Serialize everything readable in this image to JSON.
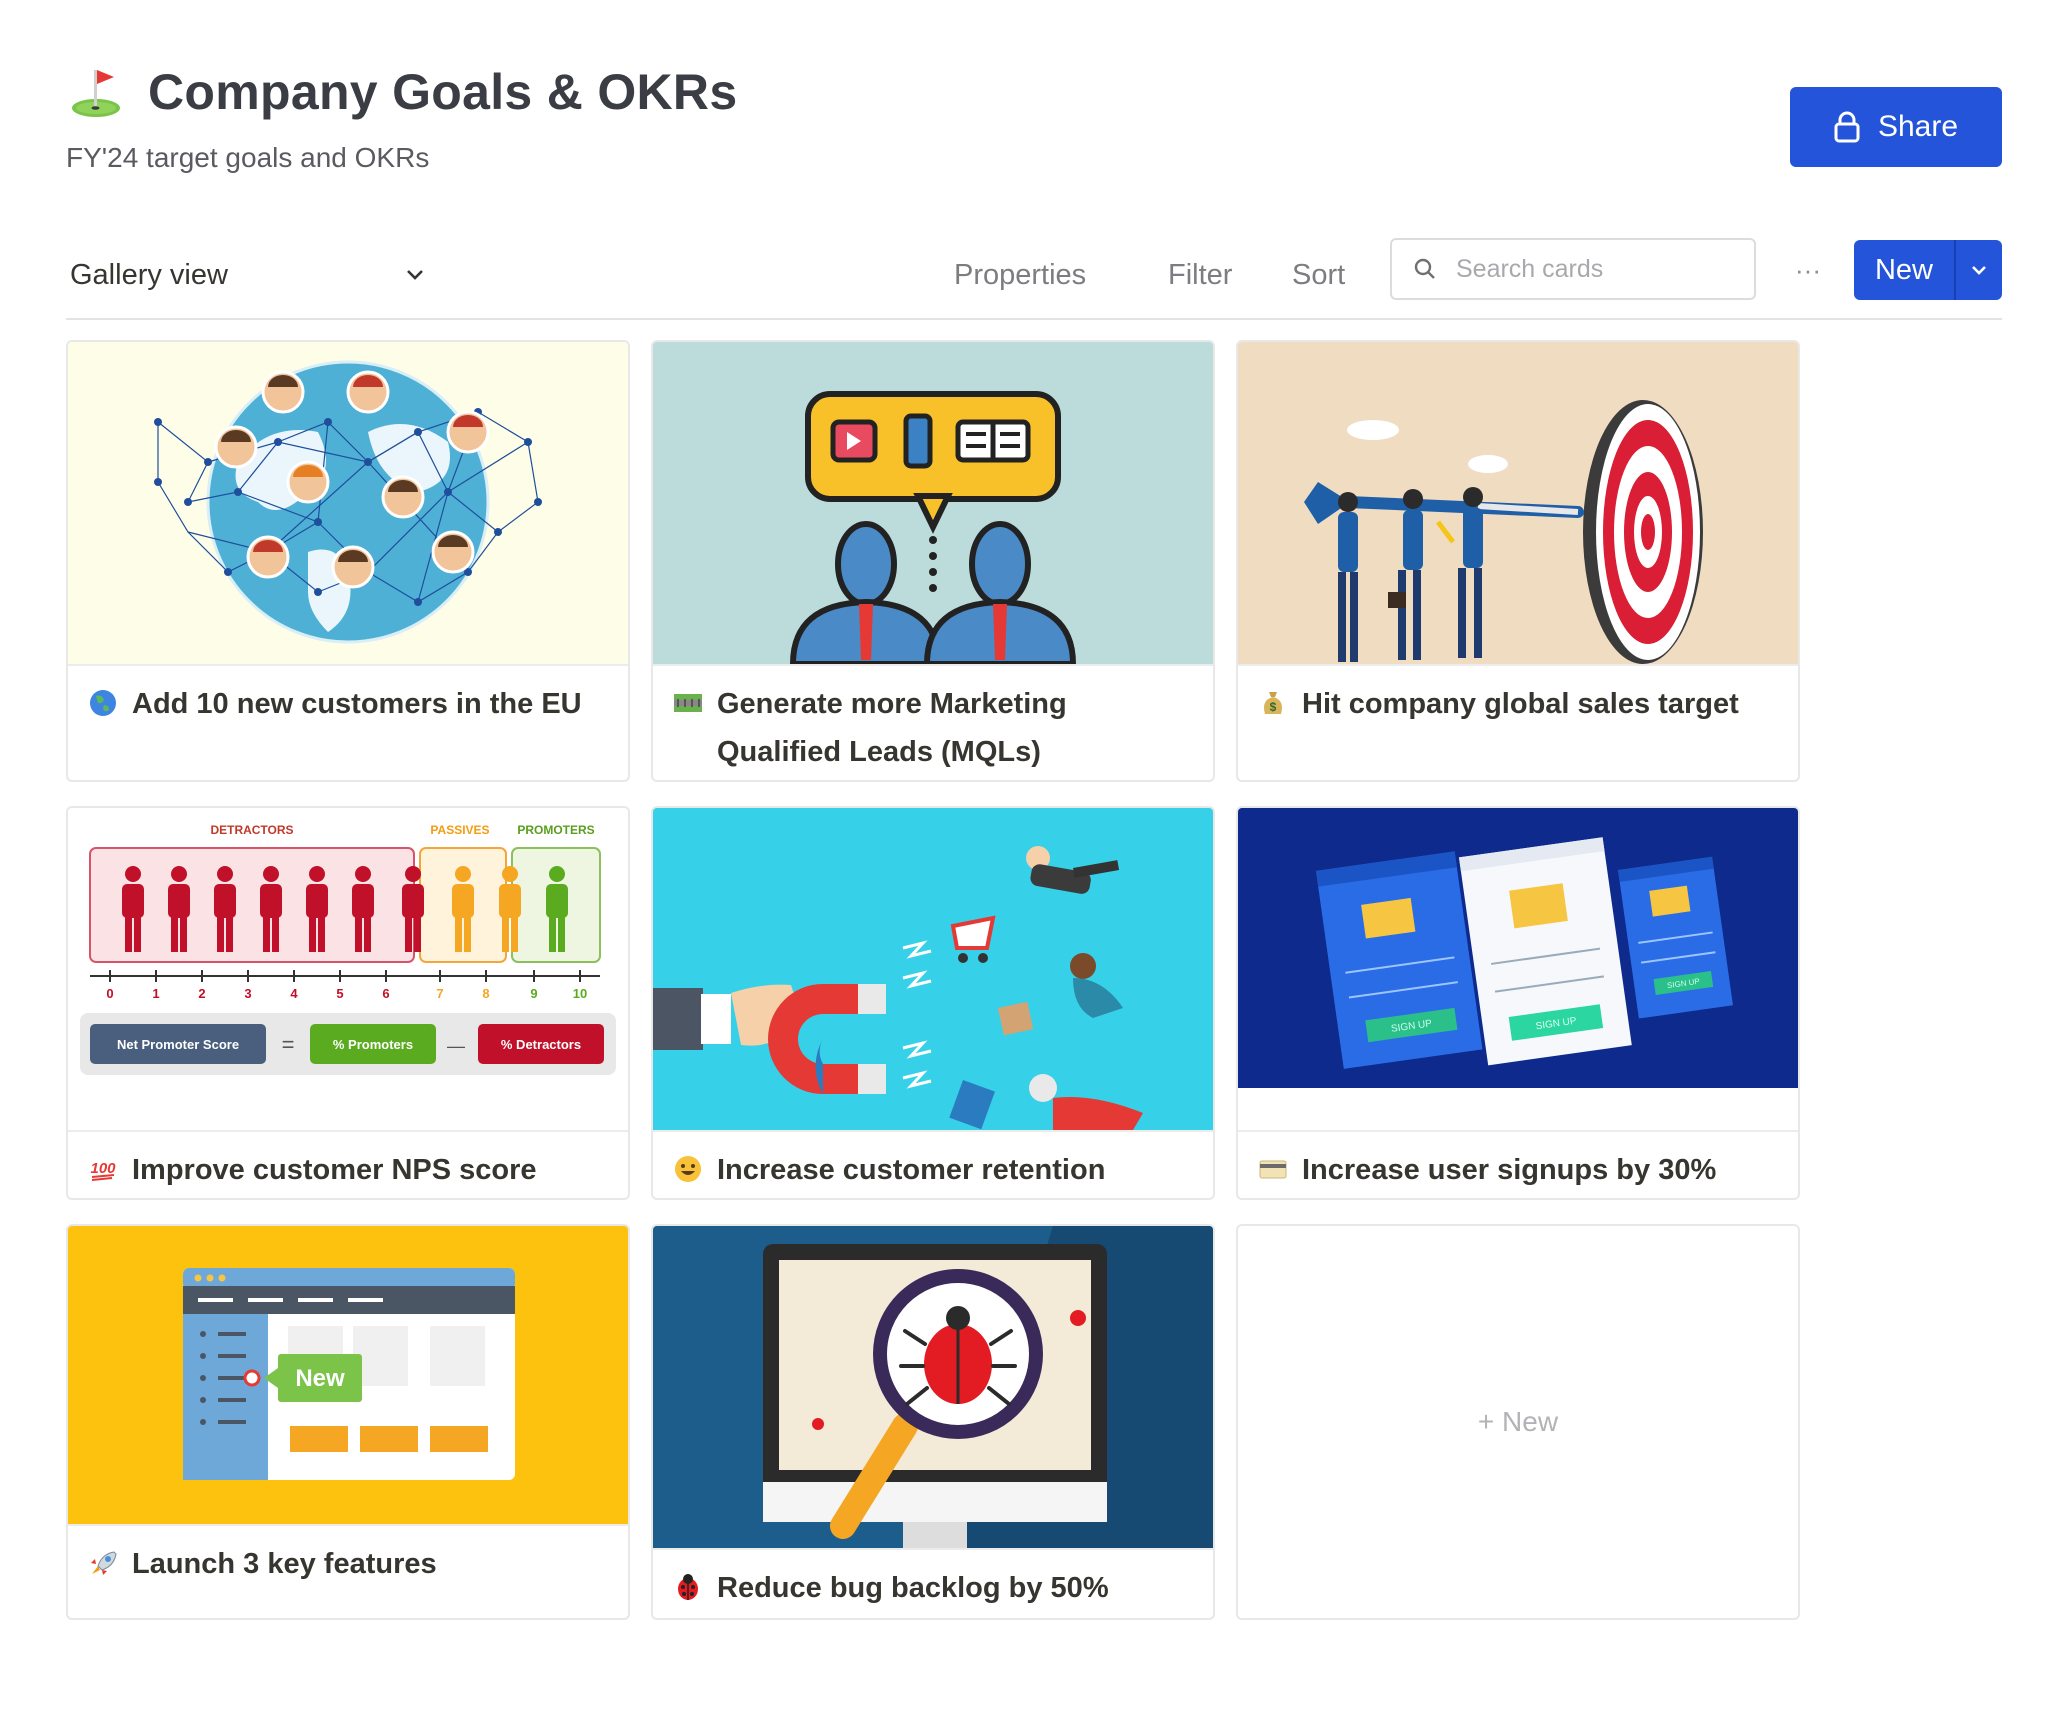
{
  "page": {
    "title": "Company Goals & OKRs",
    "subtitle": "FY'24 target goals and OKRs",
    "icon": "golf-flag-icon",
    "share_label": "Share"
  },
  "toolbar": {
    "view_label": "Gallery view",
    "properties_label": "Properties",
    "filter_label": "Filter",
    "sort_label": "Sort",
    "search_placeholder": "Search cards",
    "more_label": "···",
    "new_label": "New"
  },
  "cards": [
    {
      "title": "Add 10 new customers in the EU",
      "emoji": "globe-icon",
      "cover": "world-map-network-illustration"
    },
    {
      "title": "Generate more Marketing Qualified Leads (MQLs)",
      "emoji": "railway-track-icon",
      "cover": "marketing-communication-illustration"
    },
    {
      "title": "Hit company global sales target",
      "emoji": "money-bag-icon",
      "cover": "team-dart-target-illustration"
    },
    {
      "title": "Improve customer NPS score",
      "emoji": "hundred-points-icon",
      "cover": "nps-chart-illustration",
      "nps": {
        "detractors": "DETRACTORS",
        "passives": "PASSIVES",
        "promoters": "PROMOTERS",
        "scale": [
          "0",
          "1",
          "2",
          "3",
          "4",
          "5",
          "6",
          "7",
          "8",
          "9",
          "10"
        ],
        "nps_label": "Net Promoter Score",
        "promoters_label": "% Promoters",
        "detractors_label": "% Detractors",
        "equals": "=",
        "minus": "—"
      }
    },
    {
      "title": "Increase customer retention",
      "emoji": "smiley-icon",
      "cover": "magnet-customers-illustration"
    },
    {
      "title": "Increase user signups by 30%",
      "emoji": "credit-card-icon",
      "cover": "signup-forms-illustration",
      "signup_labels": [
        "SIGN UP",
        "SIGN UP",
        "SIGN UP"
      ]
    },
    {
      "title": "Launch 3 key features",
      "emoji": "rocket-icon",
      "cover": "new-feature-illustration",
      "feature_badge": "New"
    },
    {
      "title": "Reduce bug backlog by 50%",
      "emoji": "ladybug-icon",
      "cover": "bug-magnifier-illustration"
    }
  ],
  "new_card_label": "+ New",
  "colors": {
    "accent": "#2454d9",
    "text": "#37352f",
    "muted": "#7c7d80"
  }
}
